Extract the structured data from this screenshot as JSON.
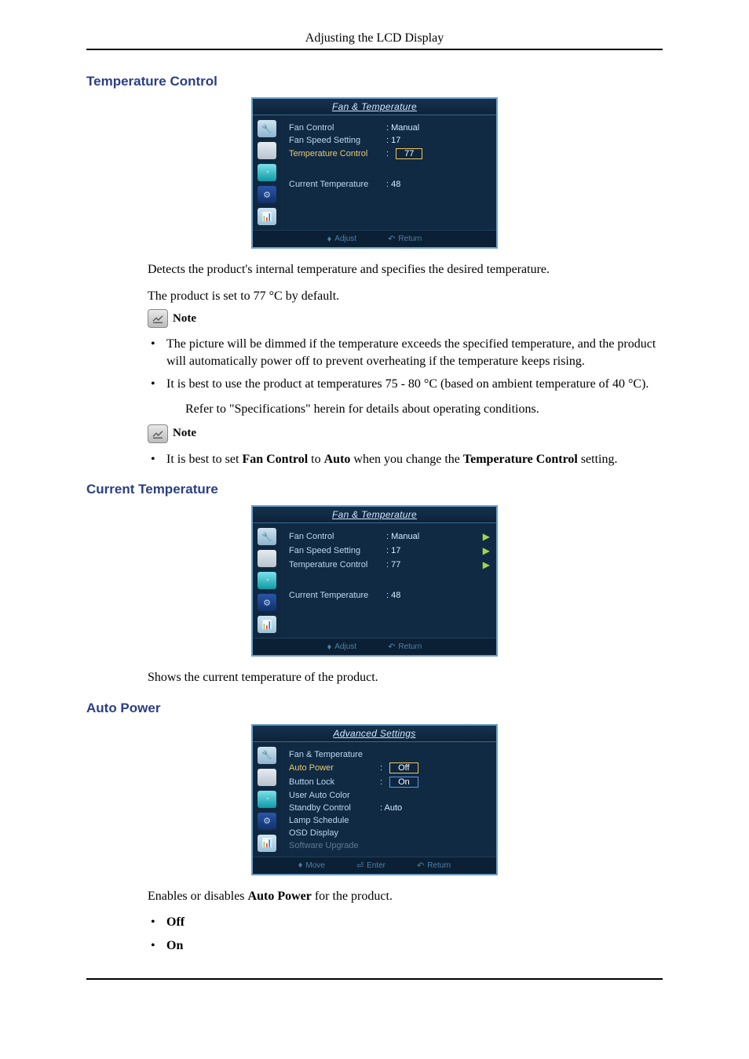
{
  "header": "Adjusting the LCD Display",
  "sections": {
    "tempControl": {
      "title": "Temperature Control",
      "para1": "Detects the product's internal temperature and specifies the desired temperature.",
      "para2": "The product is set to 77 °C by default.",
      "note1Label": "Note",
      "bullets": [
        "The picture will be dimmed if the temperature exceeds the specified temperature, and the product will automatically power off to prevent overheating if the temperature keeps rising.",
        "It is best to use the product at temperatures 75 - 80 °C (based on ambient temperature of 40 °C)."
      ],
      "subpara": "Refer to \"Specifications\" herein for details about operating conditions.",
      "note2Label": "Note",
      "bullet2_prefix": "It is best to set ",
      "bullet2_b1": "Fan Control",
      "bullet2_mid": " to ",
      "bullet2_b2": "Auto",
      "bullet2_mid2": " when you change the ",
      "bullet2_b3": "Temperature Control",
      "bullet2_suffix": " setting."
    },
    "currentTemp": {
      "title": "Current Temperature",
      "para": "Shows the current temperature of the product."
    },
    "autoPower": {
      "title": "Auto Power",
      "para_prefix": "Enables or disables ",
      "para_bold": "Auto Power",
      "para_suffix": " for the product.",
      "options": [
        "Off",
        "On"
      ]
    }
  },
  "osd1": {
    "title": "Fan & Temperature",
    "rows": [
      {
        "label": "Fan Control",
        "value": ": Manual"
      },
      {
        "label": "Fan Speed Setting",
        "value": ": 17"
      },
      {
        "label": "Temperature Control",
        "value": "77",
        "selected": true,
        "input": true
      }
    ],
    "current": {
      "label": "Current Temperature",
      "value": ": 48"
    },
    "footer": {
      "adjust": "Adjust",
      "return": "Return"
    }
  },
  "osd2": {
    "title": "Fan & Temperature",
    "rows": [
      {
        "label": "Fan Control",
        "value": ": Manual",
        "arrow": true
      },
      {
        "label": "Fan Speed Setting",
        "value": ": 17",
        "arrow": true
      },
      {
        "label": "Temperature Control",
        "value": ": 77",
        "arrow": true
      }
    ],
    "current": {
      "label": "Current Temperature",
      "value": ": 48"
    },
    "footer": {
      "adjust": "Adjust",
      "return": "Return"
    }
  },
  "osd3": {
    "title": "Advanced Settings",
    "rows": [
      {
        "label": "Fan & Temperature",
        "value": ""
      },
      {
        "label": "Auto Power",
        "value": "Off",
        "selected": true,
        "input": true
      },
      {
        "label": "Button Lock",
        "value": "On",
        "input": true
      },
      {
        "label": "User Auto Color",
        "value": ""
      },
      {
        "label": "Standby Control",
        "value": ": Auto"
      },
      {
        "label": "Lamp Schedule",
        "value": ""
      },
      {
        "label": "OSD Display",
        "value": ""
      },
      {
        "label": "Software Upgrade",
        "value": "",
        "dim": true
      }
    ],
    "footer": {
      "move": "Move",
      "enter": "Enter",
      "return": "Return"
    }
  }
}
